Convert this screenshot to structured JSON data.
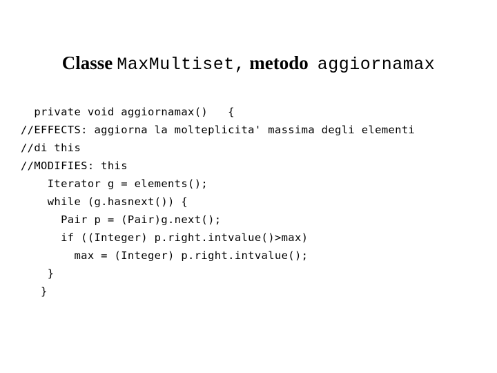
{
  "slide": {
    "background_color": "#ffffff",
    "text_color": "#000000",
    "title": {
      "prefix_label": "Classe",
      "class_name": "MaxMultiset,",
      "middle_label": "metodo",
      "method_name": "aggiornamax"
    },
    "code": {
      "language": "java",
      "lines": [
        "  private void aggiornamax()   {",
        "//EFFECTS: aggiorna la molteplicita' massima degli elementi",
        "//di this",
        "//MODIFIES: this",
        "    Iterator g = elements();",
        "    while (g.hasnext()) {",
        "      Pair p = (Pair)g.next();",
        "      if ((Integer) p.right.intvalue()>max)",
        "        max = (Integer) p.right.intvalue();",
        "    }",
        "   }"
      ]
    }
  }
}
